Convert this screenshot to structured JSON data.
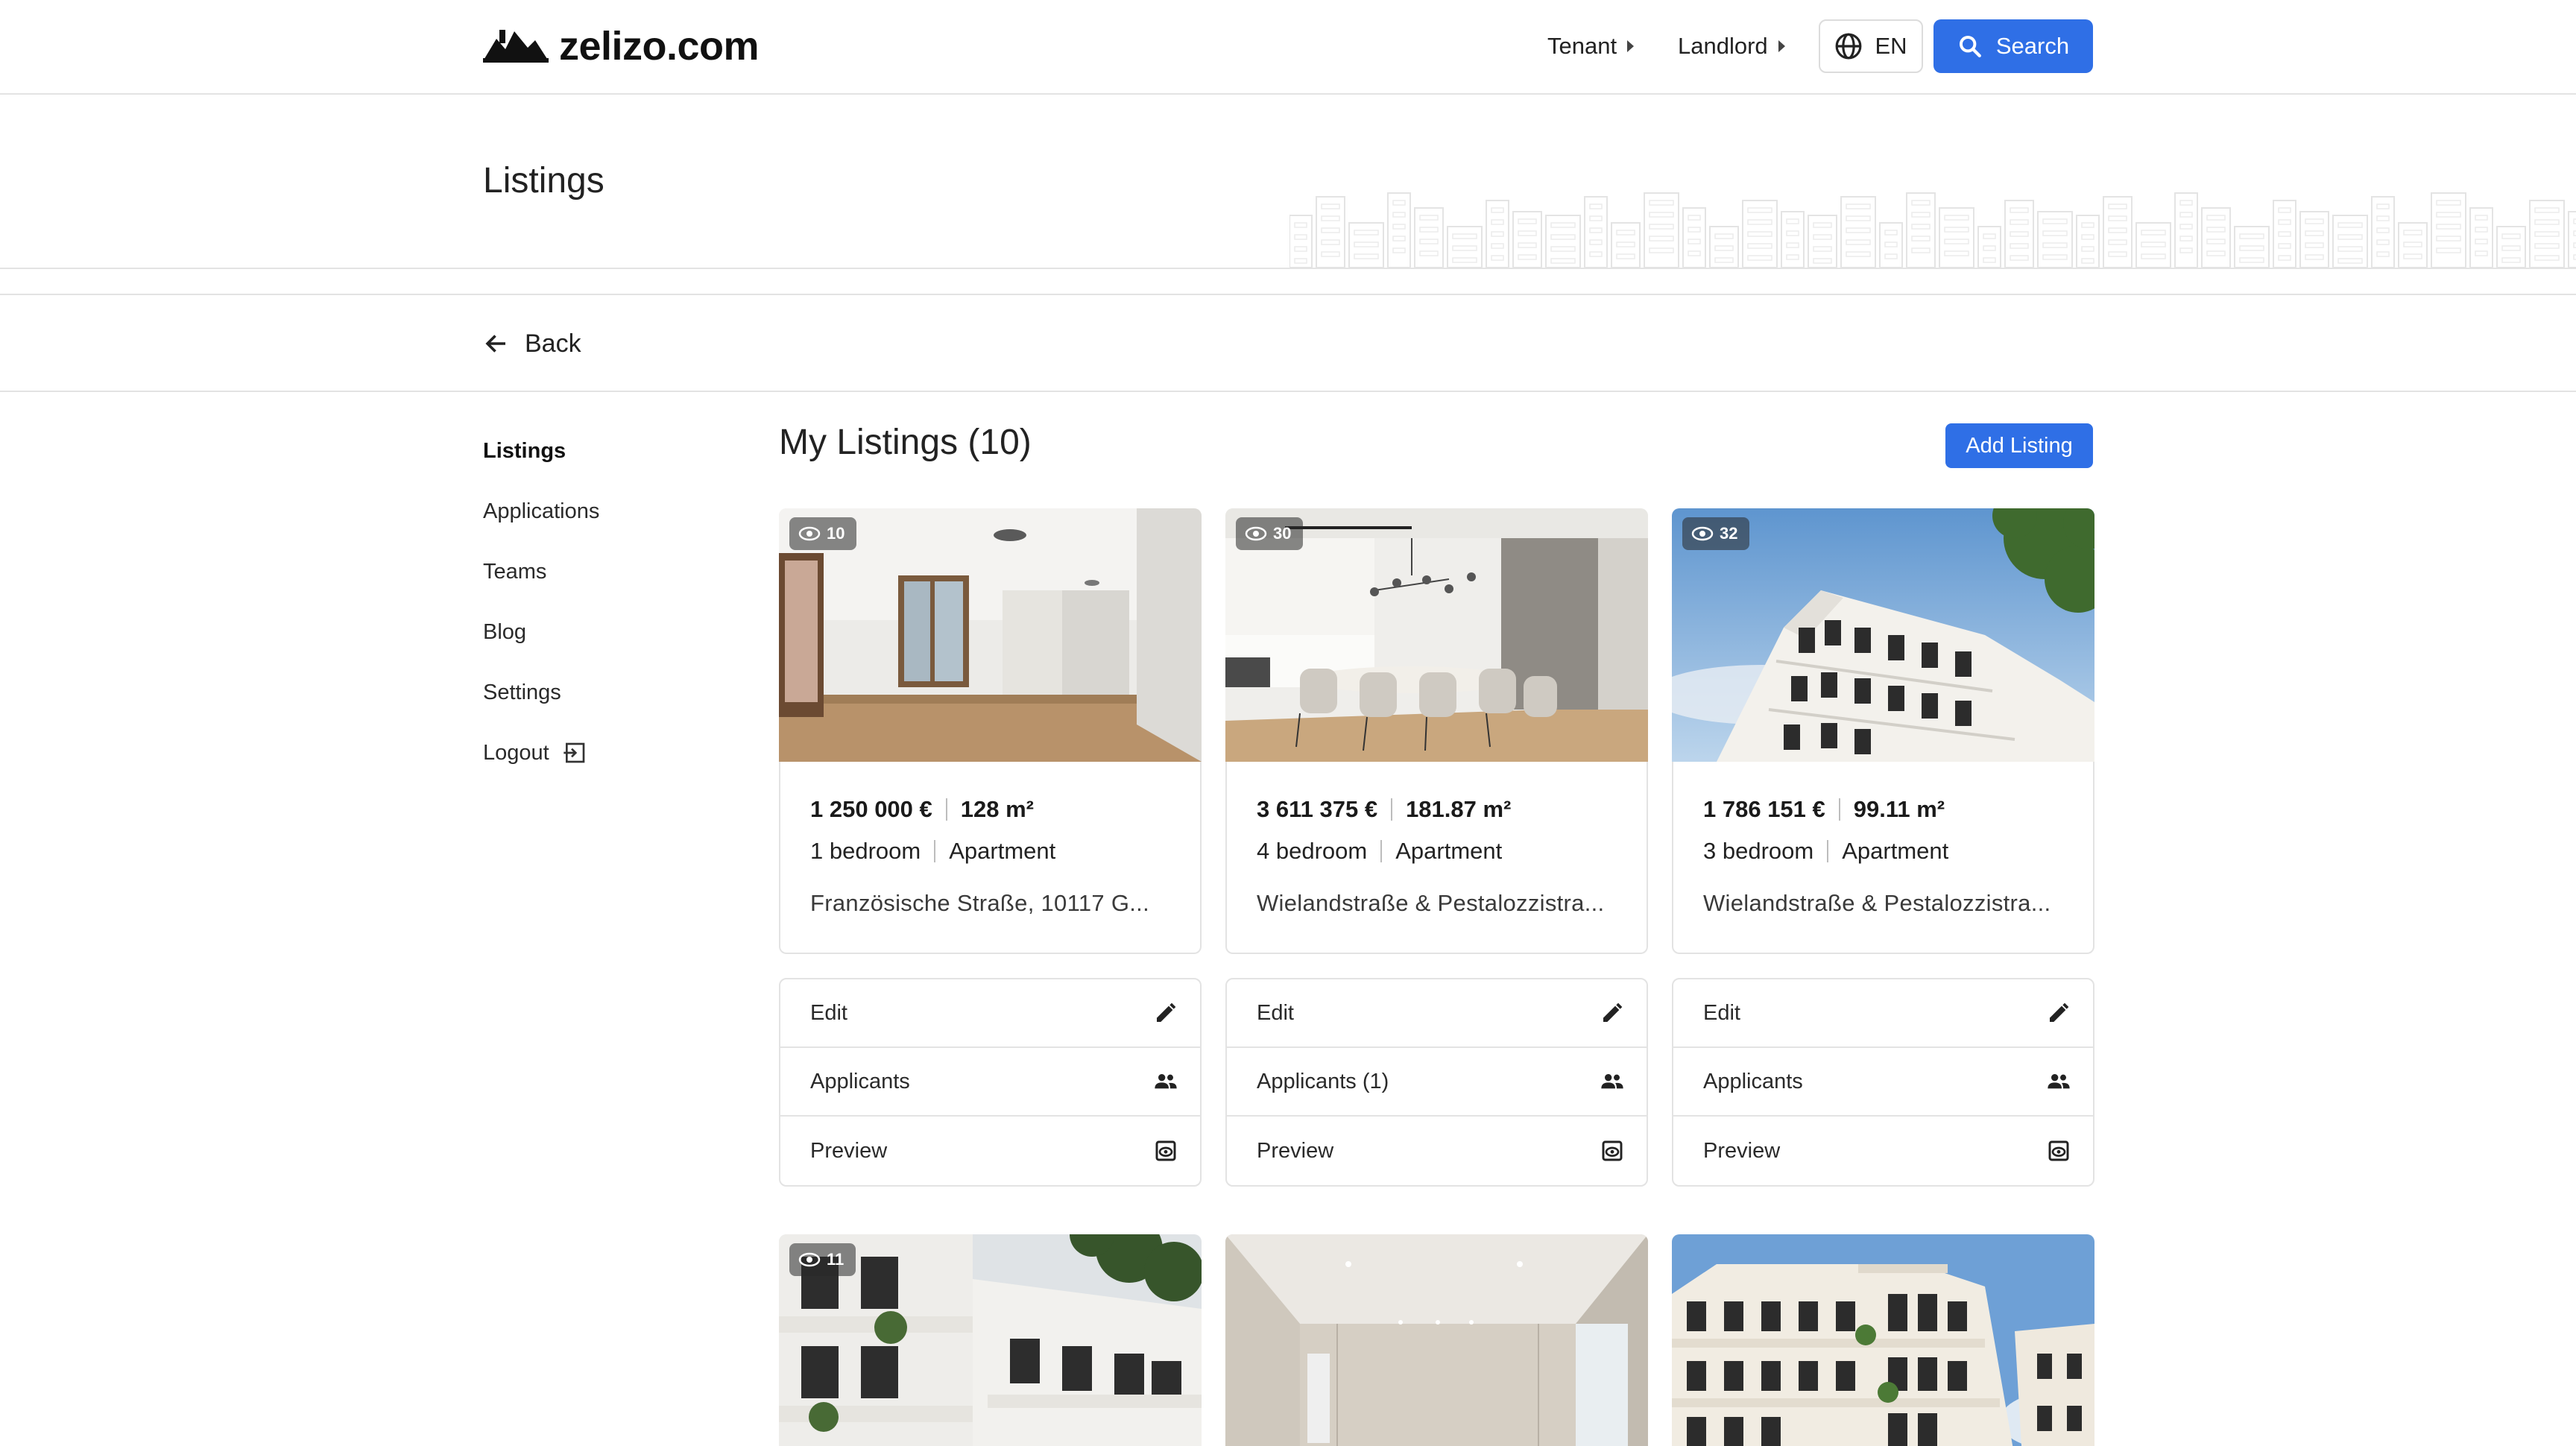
{
  "header": {
    "logo_text": "zelizo.com",
    "nav": [
      {
        "label": "Tenant"
      },
      {
        "label": "Landlord"
      }
    ],
    "language": "EN",
    "search_label": "Search"
  },
  "page_title": "Listings",
  "back_label": "Back",
  "sidebar": {
    "items": [
      {
        "label": "Listings",
        "active": true
      },
      {
        "label": "Applications"
      },
      {
        "label": "Teams"
      },
      {
        "label": "Blog"
      },
      {
        "label": "Settings"
      },
      {
        "label": "Logout"
      }
    ]
  },
  "main": {
    "title": "My Listings (10)",
    "add_label": "Add Listing"
  },
  "listings": [
    {
      "views": "10",
      "price": "1 250 000 €",
      "area": "128 m²",
      "bedrooms": "1 bedroom",
      "type": "Apartment",
      "address": "Französische Straße, 10117 G...",
      "actions": {
        "edit": "Edit",
        "applicants": "Applicants",
        "preview": "Preview"
      }
    },
    {
      "views": "30",
      "price": "3 611 375 €",
      "area": "181.87 m²",
      "bedrooms": "4 bedroom",
      "type": "Apartment",
      "address": "Wielandstraße & Pestalozzistra...",
      "actions": {
        "edit": "Edit",
        "applicants": "Applicants (1)",
        "preview": "Preview"
      }
    },
    {
      "views": "32",
      "price": "1 786 151 €",
      "area": "99.11 m²",
      "bedrooms": "3 bedroom",
      "type": "Apartment",
      "address": "Wielandstraße & Pestalozzistra...",
      "actions": {
        "edit": "Edit",
        "applicants": "Applicants",
        "preview": "Preview"
      }
    },
    {
      "views": "11"
    },
    {},
    {}
  ],
  "colors": {
    "accent": "#2f6fe6",
    "border": "#e3e3e3"
  }
}
